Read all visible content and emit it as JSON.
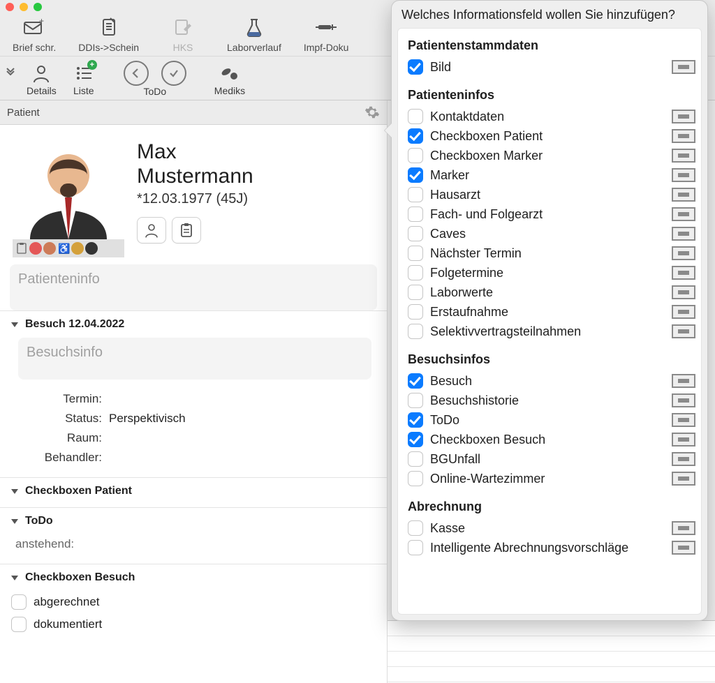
{
  "toolbar": [
    {
      "label": "Brief schr.",
      "icon": "mail"
    },
    {
      "label": "DDIs->Schein",
      "icon": "doc"
    },
    {
      "label": "HKS",
      "icon": "edit",
      "disabled": true
    },
    {
      "label": "Laborverlauf",
      "icon": "flask"
    },
    {
      "label": "Impf-Doku",
      "icon": "syringe"
    }
  ],
  "toolbar2": [
    {
      "label": "Details",
      "icon": "person"
    },
    {
      "label": "Liste",
      "icon": "list",
      "badge": "+"
    },
    {
      "label": "",
      "icon": "back-circle"
    },
    {
      "label": "ToDo",
      "icon": "check-circle"
    },
    {
      "label": "Mediks",
      "icon": "pills"
    }
  ],
  "pane_title": "Patient",
  "patient": {
    "first_name": "Max",
    "last_name": "Mustermann",
    "dob_line": "*12.03.1977 (45J)"
  },
  "patienteninfo_placeholder": "Patienteninfo",
  "visit": {
    "header": "Besuch 12.04.2022",
    "info_placeholder": "Besuchsinfo",
    "rows": [
      {
        "k": "Termin:",
        "v": ""
      },
      {
        "k": "Status:",
        "v": "Perspektivisch"
      },
      {
        "k": "Raum:",
        "v": ""
      },
      {
        "k": "Behandler:",
        "v": ""
      }
    ]
  },
  "section_cb_patient": "Checkboxen Patient",
  "section_todo": "ToDo",
  "todo_pending": "anstehend:",
  "section_cb_besuch": "Checkboxen Besuch",
  "cb_besuch_items": [
    {
      "label": "abgerechnet",
      "checked": false
    },
    {
      "label": "dokumentiert",
      "checked": false
    }
  ],
  "popover": {
    "title": "Welches Informationsfeld wollen Sie hinzufügen?",
    "groups": [
      {
        "title": "Patientenstammdaten",
        "items": [
          {
            "label": "Bild",
            "checked": true
          }
        ]
      },
      {
        "title": "Patienteninfos",
        "items": [
          {
            "label": "Kontaktdaten",
            "checked": false
          },
          {
            "label": "Checkboxen Patient",
            "checked": true
          },
          {
            "label": "Checkboxen Marker",
            "checked": false
          },
          {
            "label": "Marker",
            "checked": true
          },
          {
            "label": "Hausarzt",
            "checked": false
          },
          {
            "label": "Fach- und Folgearzt",
            "checked": false
          },
          {
            "label": "Caves",
            "checked": false
          },
          {
            "label": "Nächster Termin",
            "checked": false
          },
          {
            "label": "Folgetermine",
            "checked": false
          },
          {
            "label": "Laborwerte",
            "checked": false
          },
          {
            "label": "Erstaufnahme",
            "checked": false
          },
          {
            "label": "Selektivvertragsteilnahmen",
            "checked": false
          }
        ]
      },
      {
        "title": "Besuchsinfos",
        "items": [
          {
            "label": "Besuch",
            "checked": true
          },
          {
            "label": "Besuchshistorie",
            "checked": false
          },
          {
            "label": "ToDo",
            "checked": true
          },
          {
            "label": "Checkboxen Besuch",
            "checked": true
          },
          {
            "label": "BGUnfall",
            "checked": false
          },
          {
            "label": "Online-Wartezimmer",
            "checked": false
          }
        ]
      },
      {
        "title": "Abrechnung",
        "items": [
          {
            "label": "Kasse",
            "checked": false
          },
          {
            "label": "Intelligente Abrechnungsvorschläge",
            "checked": false
          }
        ]
      }
    ]
  }
}
